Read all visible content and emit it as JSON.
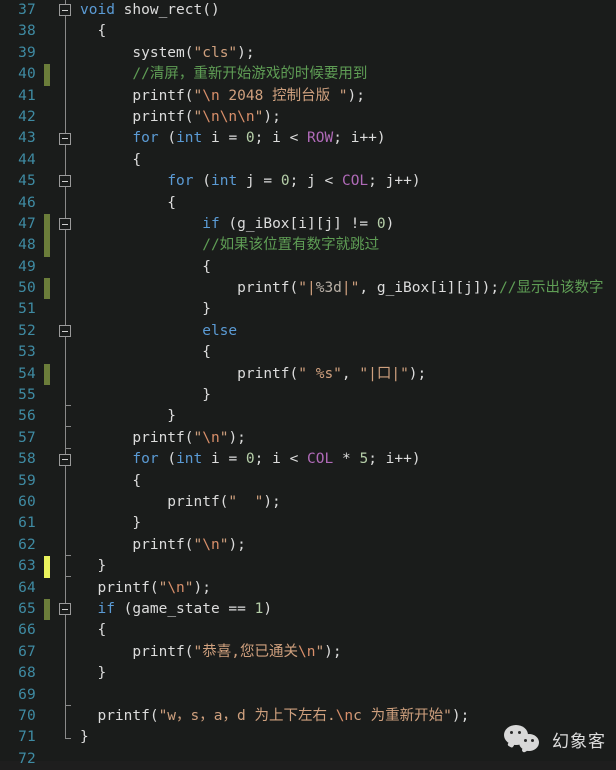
{
  "editor": {
    "theme": "visual-studio-dark",
    "colors": {
      "background": "#1a1c1b",
      "line_number": "#3f8ba3",
      "text": "#dcdcdc",
      "keyword": "#5b9bd5",
      "macro": "#b06ab8",
      "string": "#cfa07e",
      "comment": "#5f9e55",
      "change_saved": "#6b7d3a",
      "change_unsaved": "#e9f25c"
    },
    "first_line": 37,
    "last_line": 72
  },
  "lines": [
    {
      "n": 37,
      "fold": "open",
      "change": "none",
      "tokens": [
        {
          "t": "void",
          "c": "kw"
        },
        {
          "t": " show_rect()",
          "c": "pl"
        }
      ]
    },
    {
      "n": 38,
      "fold": "line",
      "change": "none",
      "tokens": [
        {
          "t": "  {",
          "c": "pl"
        }
      ]
    },
    {
      "n": 39,
      "fold": "line",
      "change": "none",
      "tokens": [
        {
          "t": "      system(",
          "c": "pl"
        },
        {
          "t": "\"cls\"",
          "c": "str"
        },
        {
          "t": ");",
          "c": "pl"
        }
      ]
    },
    {
      "n": 40,
      "fold": "line",
      "change": "saved",
      "tokens": [
        {
          "t": "      //清屏，重新开始游戏的时候要用到",
          "c": "cmt"
        }
      ]
    },
    {
      "n": 41,
      "fold": "line",
      "change": "none",
      "tokens": [
        {
          "t": "      printf(",
          "c": "pl"
        },
        {
          "t": "\"",
          "c": "str"
        },
        {
          "t": "\\n",
          "c": "esc"
        },
        {
          "t": " 2048 控制台版 \"",
          "c": "str"
        },
        {
          "t": ");",
          "c": "pl"
        }
      ]
    },
    {
      "n": 42,
      "fold": "line",
      "change": "none",
      "tokens": [
        {
          "t": "      printf(",
          "c": "pl"
        },
        {
          "t": "\"",
          "c": "str"
        },
        {
          "t": "\\n\\n\\n",
          "c": "esc"
        },
        {
          "t": "\"",
          "c": "str"
        },
        {
          "t": ");",
          "c": "pl"
        }
      ]
    },
    {
      "n": 43,
      "fold": "open",
      "change": "none",
      "tokens": [
        {
          "t": "      ",
          "c": "pl"
        },
        {
          "t": "for",
          "c": "kw"
        },
        {
          "t": " (",
          "c": "pl"
        },
        {
          "t": "int",
          "c": "type"
        },
        {
          "t": " i = ",
          "c": "pl"
        },
        {
          "t": "0",
          "c": "num"
        },
        {
          "t": "; i < ",
          "c": "pl"
        },
        {
          "t": "ROW",
          "c": "macro"
        },
        {
          "t": "; i++)",
          "c": "pl"
        }
      ]
    },
    {
      "n": 44,
      "fold": "line",
      "change": "none",
      "tokens": [
        {
          "t": "      {",
          "c": "pl"
        }
      ]
    },
    {
      "n": 45,
      "fold": "open",
      "change": "none",
      "tokens": [
        {
          "t": "          ",
          "c": "pl"
        },
        {
          "t": "for",
          "c": "kw"
        },
        {
          "t": " (",
          "c": "pl"
        },
        {
          "t": "int",
          "c": "type"
        },
        {
          "t": " j = ",
          "c": "pl"
        },
        {
          "t": "0",
          "c": "num"
        },
        {
          "t": "; j < ",
          "c": "pl"
        },
        {
          "t": "COL",
          "c": "macro"
        },
        {
          "t": "; j++)",
          "c": "pl"
        }
      ]
    },
    {
      "n": 46,
      "fold": "line",
      "change": "none",
      "tokens": [
        {
          "t": "          {",
          "c": "pl"
        }
      ]
    },
    {
      "n": 47,
      "fold": "open",
      "change": "saved",
      "tokens": [
        {
          "t": "              ",
          "c": "pl"
        },
        {
          "t": "if",
          "c": "kw"
        },
        {
          "t": " (g_iBox[i][j] != ",
          "c": "pl"
        },
        {
          "t": "0",
          "c": "num"
        },
        {
          "t": ")",
          "c": "pl"
        }
      ]
    },
    {
      "n": 48,
      "fold": "line",
      "change": "saved",
      "tokens": [
        {
          "t": "              //如果该位置有数字就跳过",
          "c": "cmt"
        }
      ]
    },
    {
      "n": 49,
      "fold": "line",
      "change": "none",
      "tokens": [
        {
          "t": "              {",
          "c": "pl"
        }
      ]
    },
    {
      "n": 50,
      "fold": "line",
      "change": "saved",
      "tokens": [
        {
          "t": "                  printf(",
          "c": "pl"
        },
        {
          "t": "\"|",
          "c": "str"
        },
        {
          "t": "%3d",
          "c": "fmt"
        },
        {
          "t": "|\"",
          "c": "str"
        },
        {
          "t": ", g_iBox[i][j]);",
          "c": "pl"
        },
        {
          "t": "//显示出该数字",
          "c": "cmt"
        }
      ]
    },
    {
      "n": 51,
      "fold": "line",
      "change": "none",
      "tokens": [
        {
          "t": "              }",
          "c": "pl"
        }
      ]
    },
    {
      "n": 52,
      "fold": "open",
      "change": "none",
      "tokens": [
        {
          "t": "              ",
          "c": "pl"
        },
        {
          "t": "else",
          "c": "kw"
        }
      ]
    },
    {
      "n": 53,
      "fold": "line",
      "change": "none",
      "tokens": [
        {
          "t": "              {",
          "c": "pl"
        }
      ]
    },
    {
      "n": 54,
      "fold": "line",
      "change": "saved",
      "tokens": [
        {
          "t": "                  printf(",
          "c": "pl"
        },
        {
          "t": "\" %s\"",
          "c": "str"
        },
        {
          "t": ", ",
          "c": "pl"
        },
        {
          "t": "\"|口|\"",
          "c": "str"
        },
        {
          "t": ");",
          "c": "pl"
        }
      ]
    },
    {
      "n": 55,
      "fold": "tick-bot",
      "change": "none",
      "tokens": [
        {
          "t": "              }",
          "c": "pl"
        }
      ]
    },
    {
      "n": 56,
      "fold": "tick-bot",
      "change": "none",
      "tokens": [
        {
          "t": "          }",
          "c": "pl"
        }
      ]
    },
    {
      "n": 57,
      "fold": "tick-bot",
      "change": "none",
      "tokens": [
        {
          "t": "      printf(",
          "c": "pl"
        },
        {
          "t": "\"",
          "c": "str"
        },
        {
          "t": "\\n",
          "c": "esc"
        },
        {
          "t": "\"",
          "c": "str"
        },
        {
          "t": ");",
          "c": "pl"
        }
      ]
    },
    {
      "n": 58,
      "fold": "open",
      "change": "none",
      "tokens": [
        {
          "t": "      ",
          "c": "pl"
        },
        {
          "t": "for",
          "c": "kw"
        },
        {
          "t": " (",
          "c": "pl"
        },
        {
          "t": "int",
          "c": "type"
        },
        {
          "t": " i = ",
          "c": "pl"
        },
        {
          "t": "0",
          "c": "num"
        },
        {
          "t": "; i < ",
          "c": "pl"
        },
        {
          "t": "COL",
          "c": "macro"
        },
        {
          "t": " * ",
          "c": "pl"
        },
        {
          "t": "5",
          "c": "num"
        },
        {
          "t": "; i++)",
          "c": "pl"
        }
      ]
    },
    {
      "n": 59,
      "fold": "line",
      "change": "none",
      "tokens": [
        {
          "t": "      {",
          "c": "pl"
        }
      ]
    },
    {
      "n": 60,
      "fold": "line",
      "change": "none",
      "tokens": [
        {
          "t": "          printf(",
          "c": "pl"
        },
        {
          "t": "\"  \"",
          "c": "str"
        },
        {
          "t": ");",
          "c": "pl"
        }
      ]
    },
    {
      "n": 61,
      "fold": "line",
      "change": "none",
      "tokens": [
        {
          "t": "      }",
          "c": "pl"
        }
      ]
    },
    {
      "n": 62,
      "fold": "tick-bot",
      "change": "none",
      "tokens": [
        {
          "t": "      printf(",
          "c": "pl"
        },
        {
          "t": "\"",
          "c": "str"
        },
        {
          "t": "\\n",
          "c": "esc"
        },
        {
          "t": "\"",
          "c": "str"
        },
        {
          "t": ");",
          "c": "pl"
        }
      ]
    },
    {
      "n": 63,
      "fold": "tick-bot",
      "change": "unsaved",
      "tokens": [
        {
          "t": "  }",
          "c": "pl"
        }
      ]
    },
    {
      "n": 64,
      "fold": "line",
      "change": "none",
      "tokens": [
        {
          "t": "  printf(",
          "c": "pl"
        },
        {
          "t": "\"",
          "c": "str"
        },
        {
          "t": "\\n",
          "c": "esc"
        },
        {
          "t": "\"",
          "c": "str"
        },
        {
          "t": ");",
          "c": "pl"
        }
      ]
    },
    {
      "n": 65,
      "fold": "open",
      "change": "saved",
      "tokens": [
        {
          "t": "  ",
          "c": "pl"
        },
        {
          "t": "if",
          "c": "kw"
        },
        {
          "t": " (game_state == ",
          "c": "pl"
        },
        {
          "t": "1",
          "c": "num"
        },
        {
          "t": ")",
          "c": "pl"
        }
      ]
    },
    {
      "n": 66,
      "fold": "line",
      "change": "none",
      "tokens": [
        {
          "t": "  {",
          "c": "pl"
        }
      ]
    },
    {
      "n": 67,
      "fold": "line",
      "change": "none",
      "tokens": [
        {
          "t": "      printf(",
          "c": "pl"
        },
        {
          "t": "\"恭喜,您已通关",
          "c": "str"
        },
        {
          "t": "\\n",
          "c": "esc"
        },
        {
          "t": "\"",
          "c": "str"
        },
        {
          "t": ");",
          "c": "pl"
        }
      ]
    },
    {
      "n": 68,
      "fold": "line",
      "change": "none",
      "tokens": [
        {
          "t": "  }",
          "c": "pl"
        }
      ]
    },
    {
      "n": 69,
      "fold": "tick-bot",
      "change": "none",
      "tokens": []
    },
    {
      "n": 70,
      "fold": "line",
      "change": "none",
      "tokens": [
        {
          "t": "  printf(",
          "c": "pl"
        },
        {
          "t": "\"w，s，a，d 为上下左右.",
          "c": "str"
        },
        {
          "t": "\\n",
          "c": "esc"
        },
        {
          "t": "c 为重新开始\"",
          "c": "str"
        },
        {
          "t": ");",
          "c": "pl"
        }
      ]
    },
    {
      "n": 71,
      "fold": "end",
      "change": "none",
      "tokens": [
        {
          "t": "}",
          "c": "pl"
        }
      ]
    },
    {
      "n": 72,
      "fold": "none",
      "change": "none",
      "tokens": []
    }
  ],
  "watermark": {
    "text": "幻象客",
    "icon": "wechat-logo"
  }
}
